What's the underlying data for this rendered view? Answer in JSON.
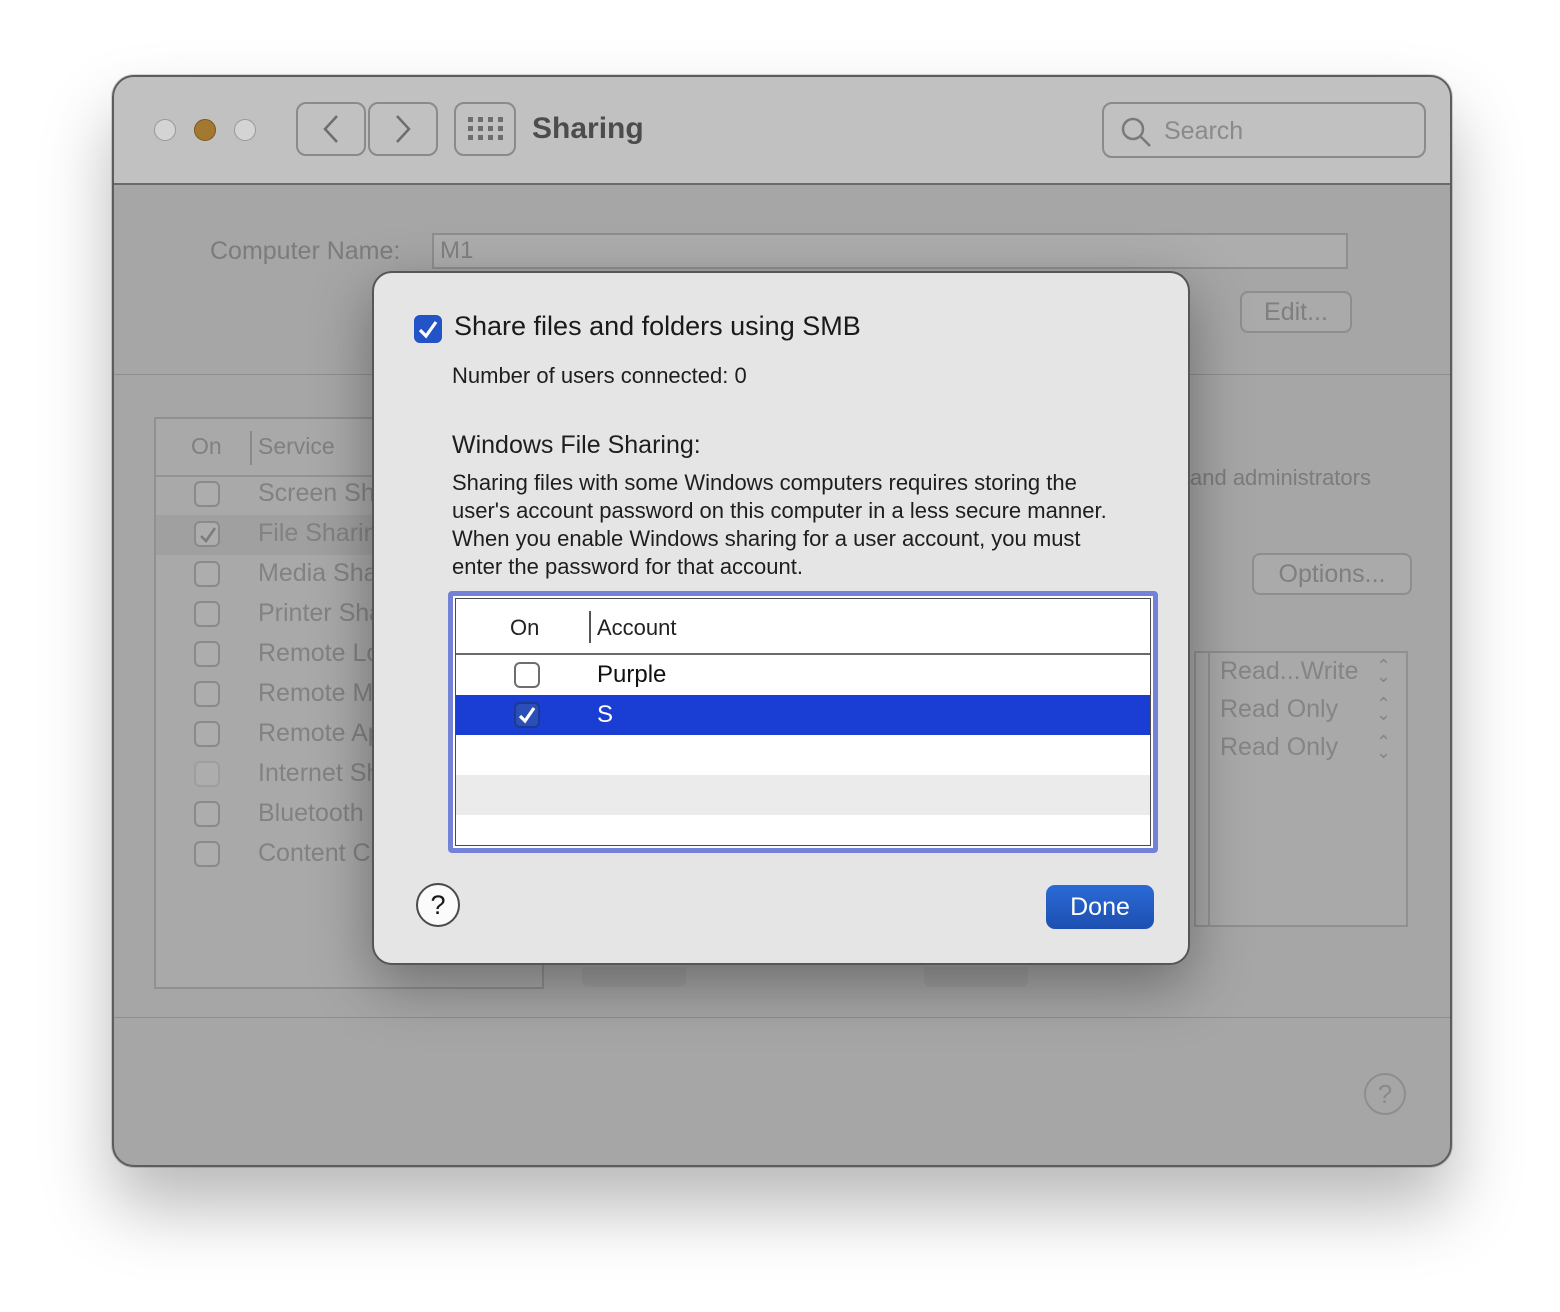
{
  "window": {
    "title": "Sharing",
    "search_placeholder": "Search"
  },
  "background": {
    "computer_name_label": "Computer Name:",
    "computer_name_value": "M1",
    "edit_button": "Edit...",
    "options_button": "Options...",
    "admin_text": "and administrators",
    "services_header": {
      "on": "On",
      "service": "Service"
    },
    "services": [
      {
        "label": "Screen Sh",
        "checked": false
      },
      {
        "label": "File Sharin",
        "checked": true
      },
      {
        "label": "Media Sha",
        "checked": false
      },
      {
        "label": "Printer Sha",
        "checked": false
      },
      {
        "label": "Remote Lo",
        "checked": false
      },
      {
        "label": "Remote M",
        "checked": false
      },
      {
        "label": "Remote Ap",
        "checked": false
      },
      {
        "label": "Internet Sh",
        "checked": false
      },
      {
        "label": "Bluetooth",
        "checked": false
      },
      {
        "label": "Content C",
        "checked": false
      }
    ],
    "permissions": [
      "Read...Write",
      "Read Only",
      "Read Only"
    ],
    "help_label": "?"
  },
  "sheet": {
    "smb_checkbox_label": "Share files and folders using SMB",
    "smb_checked": true,
    "users_connected": "Number of users connected: 0",
    "wfs_title": "Windows File Sharing:",
    "wfs_description": "Sharing files with some Windows computers requires storing the user's account password on this computer in a less secure manner. When you enable Windows sharing for a user account, you must enter the password for that account.",
    "table_header": {
      "on": "On",
      "account": "Account"
    },
    "accounts": [
      {
        "name": "Purple",
        "enabled": false,
        "selected": false
      },
      {
        "name": "S",
        "enabled": true,
        "selected": true
      }
    ],
    "help_label": "?",
    "done_button": "Done"
  },
  "colors": {
    "accent": "#1a3ed4",
    "checkbox_blue": "#2254c8",
    "done_button": "#1d4fb0",
    "traffic_minimize": "#a37830"
  }
}
